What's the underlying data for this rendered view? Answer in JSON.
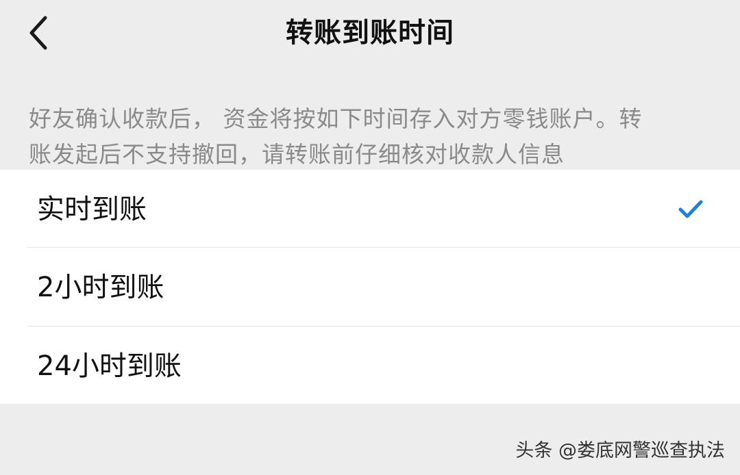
{
  "header": {
    "title": "转账到账时间",
    "back_icon": "chevron-left-icon"
  },
  "notice": {
    "line1": "好友确认收款后， 资金将按如下时间存入对方零钱账户。转",
    "line2": "账发起后不支持撤回，请转账前仔细核对收款人信息"
  },
  "options": [
    {
      "label": "实时到账",
      "selected": true
    },
    {
      "label": "2小时到账",
      "selected": false
    },
    {
      "label": "24小时到账",
      "selected": false
    }
  ],
  "colors": {
    "accent": "#1f7fd9",
    "background": "#ededed",
    "card": "#ffffff"
  },
  "watermark": {
    "text": "头条 @娄底网警巡查执法"
  }
}
